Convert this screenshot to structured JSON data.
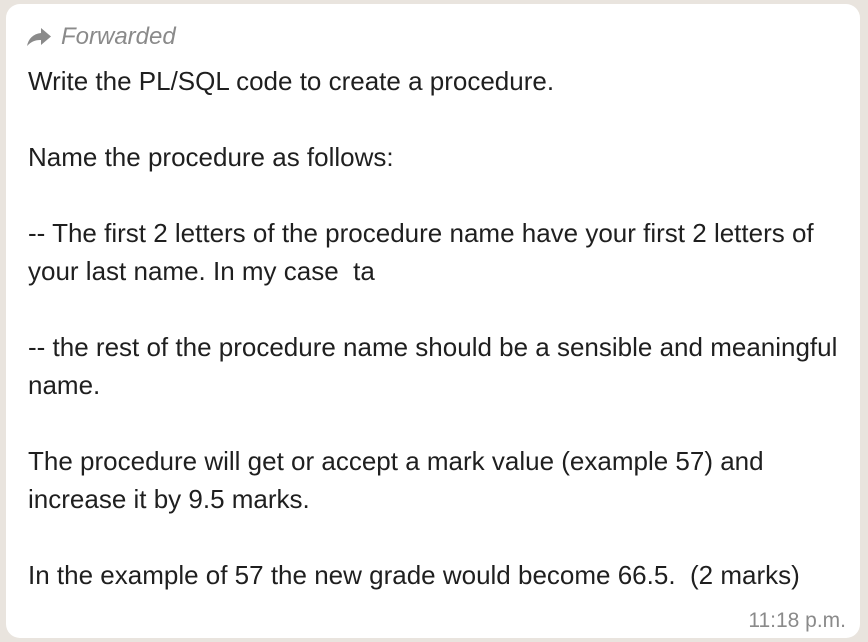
{
  "forwarded": {
    "icon": "forward-arrow-icon",
    "label": "Forwarded"
  },
  "message": {
    "paragraphs": [
      "Write the PL/SQL code to create a procedure.",
      "Name the procedure as follows:",
      "-- The first 2 letters of the procedure name have your first 2 letters of your last name. In my case  ta",
      "-- the rest of the procedure name should be a sensible and meaningful name.",
      "The procedure will get or accept a mark value (example 57) and increase it by 9.5 marks.",
      "In the example of 57 the new grade would become 66.5.  (2 marks)"
    ]
  },
  "timestamp": "11:18 p.m.",
  "colors": {
    "bubble_bg": "#ffffff",
    "chat_bg": "#e9e4de",
    "meta_text": "#8a8a8a",
    "body_text": "#1f1f1f"
  }
}
